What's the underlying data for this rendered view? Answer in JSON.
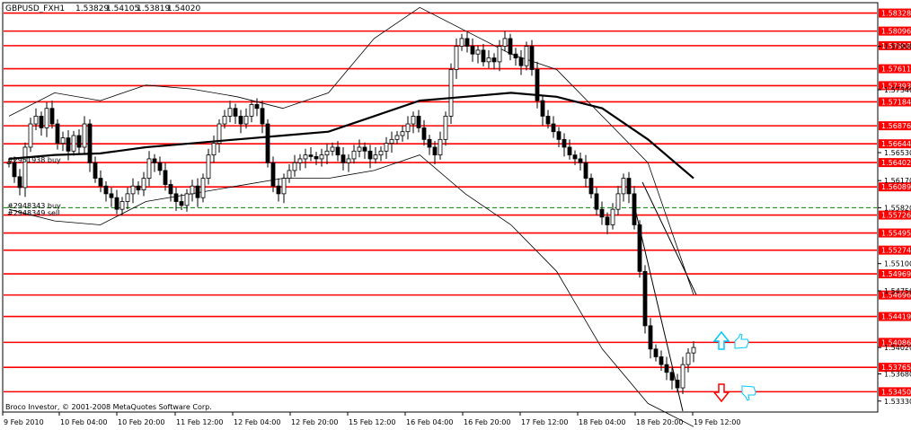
{
  "window": {
    "symbol_label": "GBPUSD_FXH1",
    "ohlc": [
      "1.53829",
      "1.54105",
      "1.53819",
      "1.54020"
    ],
    "copyright": "Broco Investor, © 2001-2008 MetaQuotes Software Corp."
  },
  "colors": {
    "background": "#ffffff",
    "grid_line": "#000000",
    "level_line": "#ff0000",
    "price_line": "#000000",
    "price_tag_fill": "#ff0000",
    "price_tag_text": "#ffffff",
    "order_line": "#008000",
    "arrow_up": "#00c8ff",
    "arrow_down": "#ff0000"
  },
  "order_labels": {
    "top": "#2951938 buy",
    "mid": "#2948343 buy",
    "bottom": "#2948349 sell"
  },
  "price_axis": {
    "red_levels": [
      "1.58328",
      "1.58096",
      "1.57908",
      "1.57611",
      "1.57393",
      "1.57184",
      "1.56876",
      "1.56644",
      "1.56402",
      "1.56089",
      "1.55726",
      "1.55495",
      "1.55274",
      "1.54969",
      "1.54696",
      "1.54419",
      "1.54086",
      "1.53765",
      "1.53450"
    ],
    "plain_labels": [
      "1.57900",
      "1.57340",
      "1.56530",
      "1.56170",
      "1.55820",
      "1.55100",
      "1.54750",
      "1.54020",
      "1.53680",
      "1.53330"
    ],
    "current_price": "1.54020"
  },
  "time_axis": {
    "labels": [
      "9 Feb 2010",
      "10 Feb 04:00",
      "10 Feb 20:00",
      "11 Feb 12:00",
      "12 Feb 04:00",
      "12 Feb 20:00",
      "15 Feb 12:00",
      "16 Feb 04:00",
      "16 Feb 20:00",
      "17 Feb 12:00",
      "18 Feb 04:00",
      "18 Feb 20:00",
      "19 Feb 12:00"
    ]
  },
  "chart_data": {
    "type": "candlestick",
    "symbol": "GBPUSD_FXH1",
    "y_range": [
      1.532,
      1.5845
    ],
    "levels": [
      1.58328,
      1.58096,
      1.57908,
      1.57611,
      1.57393,
      1.57184,
      1.56876,
      1.56644,
      1.56402,
      1.56089,
      1.55726,
      1.55495,
      1.55274,
      1.54969,
      1.54696,
      1.54419,
      1.54086,
      1.53765,
      1.5345
    ],
    "order_level": 1.5582,
    "close_path": [
      1.564,
      1.5622,
      1.5608,
      1.566,
      1.569,
      1.57,
      1.5685,
      1.571,
      1.569,
      1.5665,
      1.5672,
      1.5655,
      1.5675,
      1.566,
      1.569,
      1.564,
      1.562,
      1.561,
      1.56,
      1.5595,
      1.558,
      1.559,
      1.56,
      1.561,
      1.5605,
      1.562,
      1.5645,
      1.564,
      1.563,
      1.5612,
      1.56,
      1.559,
      1.5585,
      1.56,
      1.561,
      1.5595,
      1.562,
      1.565,
      1.5665,
      1.569,
      1.57,
      1.571,
      1.57,
      1.569,
      1.57,
      1.5715,
      1.571,
      1.569,
      1.564,
      1.561,
      1.56,
      1.562,
      1.563,
      1.564,
      1.5645,
      1.565,
      1.5648,
      1.5645,
      1.565,
      1.5655,
      1.566,
      1.565,
      1.564,
      1.5645,
      1.5655,
      1.566,
      1.5655,
      1.5645,
      1.565,
      1.5655,
      1.5665,
      1.567,
      1.5675,
      1.568,
      1.569,
      1.57,
      1.5685,
      1.567,
      1.566,
      1.565,
      1.567,
      1.57,
      1.576,
      1.579,
      1.58,
      1.579,
      1.578,
      1.5785,
      1.577,
      1.5775,
      1.577,
      1.579,
      1.58,
      1.578,
      1.5775,
      1.5765,
      1.579,
      1.576,
      1.572,
      1.57,
      1.569,
      1.568,
      1.567,
      1.566,
      1.565,
      1.5645,
      1.564,
      1.562,
      1.56,
      1.558,
      1.557,
      1.556,
      1.558,
      1.56,
      1.562,
      1.56,
      1.556,
      1.55,
      1.543,
      1.54,
      1.539,
      1.538,
      1.537,
      1.536,
      1.535,
      1.538,
      1.5395,
      1.5402
    ],
    "moving_average": [
      1.5645,
      1.565,
      1.5652,
      1.566,
      1.5665,
      1.567,
      1.5675,
      1.568,
      1.57,
      1.572,
      1.5725,
      1.573,
      1.5725,
      1.571,
      1.567,
      1.562
    ],
    "bollinger_upper": [
      1.57,
      1.573,
      1.572,
      1.574,
      1.5735,
      1.5725,
      1.571,
      1.573,
      1.58,
      1.584,
      1.581,
      1.578,
      1.576,
      1.57,
      1.564,
      1.547
    ],
    "bollinger_lower": [
      1.558,
      1.5565,
      1.556,
      1.559,
      1.56,
      1.561,
      1.562,
      1.562,
      1.563,
      1.565,
      1.56,
      1.556,
      1.55,
      1.54,
      1.533,
      1.53
    ]
  }
}
